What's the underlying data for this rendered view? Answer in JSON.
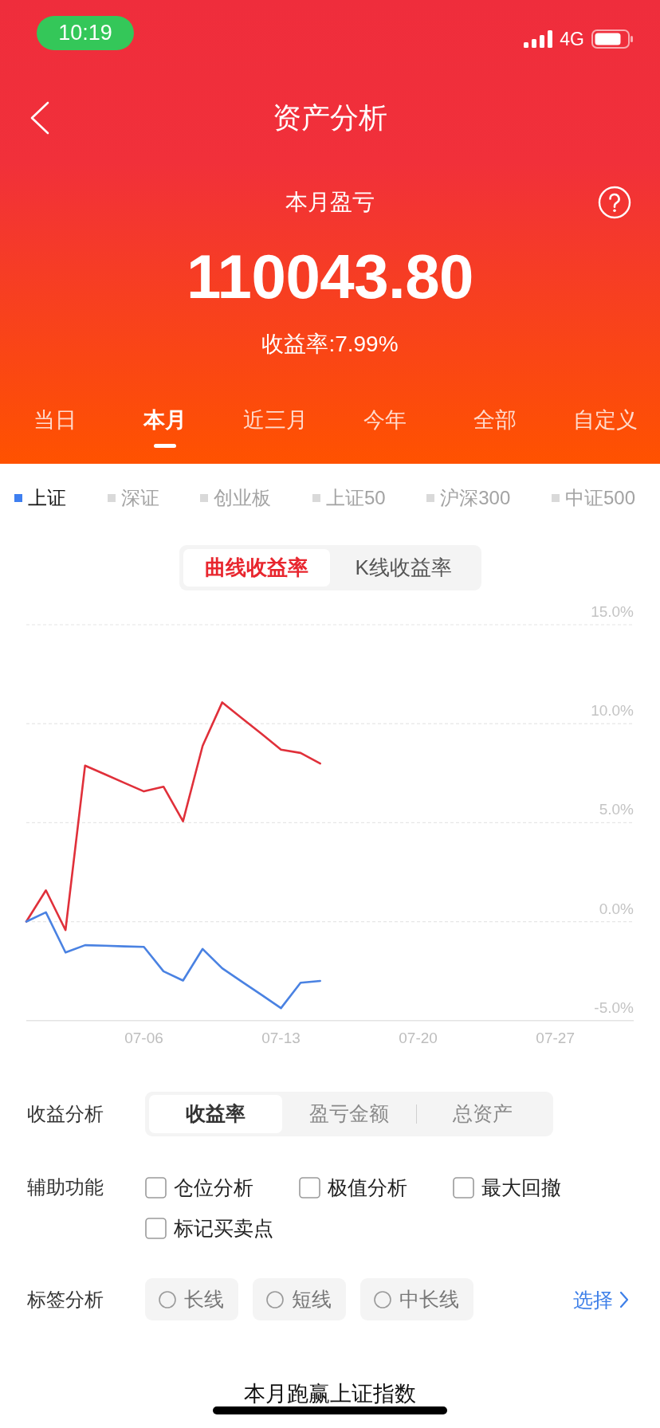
{
  "status_bar": {
    "time": "10:19",
    "network": "4G"
  },
  "nav": {
    "title": "资产分析"
  },
  "summary": {
    "label": "本月盈亏",
    "amount": "110043.80",
    "return_rate": "收益率:7.99%"
  },
  "period_tabs": [
    {
      "label": "当日",
      "selected": false
    },
    {
      "label": "本月",
      "selected": true
    },
    {
      "label": "近三月",
      "selected": false
    },
    {
      "label": "今年",
      "selected": false
    },
    {
      "label": "全部",
      "selected": false
    },
    {
      "label": "自定义",
      "selected": false
    }
  ],
  "index_legend": [
    {
      "label": "上证",
      "selected": true
    },
    {
      "label": "深证",
      "selected": false
    },
    {
      "label": "创业板",
      "selected": false
    },
    {
      "label": "上证50",
      "selected": false
    },
    {
      "label": "沪深300",
      "selected": false
    },
    {
      "label": "中证500",
      "selected": false
    }
  ],
  "chart_mode_tabs": [
    {
      "label": "曲线收益率",
      "selected": true
    },
    {
      "label": "K线收益率",
      "selected": false
    }
  ],
  "chart": {
    "chart_data": {
      "type": "line",
      "grid": true,
      "categories": [
        null,
        null,
        null,
        null,
        null,
        null,
        "07-06",
        null,
        null,
        null,
        null,
        null,
        null,
        "07-13",
        null,
        null,
        null,
        null,
        null,
        null,
        "07-20",
        null,
        null,
        null,
        null,
        null,
        null,
        "07-27",
        null,
        null,
        null,
        null
      ],
      "ylim": [
        -5,
        15
      ],
      "yticks": [
        {
          "value": -5,
          "label": "-5.0%"
        },
        {
          "value": 0,
          "label": "0.0%"
        },
        {
          "value": 5,
          "label": "5.0%"
        },
        {
          "value": 10,
          "label": "10.0%"
        },
        {
          "value": 15,
          "label": "15.0%"
        }
      ],
      "series": [
        {
          "color": "#e0303a",
          "values": [
            0,
            1.58,
            -0.43,
            7.88,
            7.45,
            7.01,
            6.58,
            6.82,
            5.07,
            8.88,
            11.08,
            10.28,
            9.49,
            8.69,
            8.52,
            7.99,
            null,
            null,
            null,
            null,
            null,
            null,
            null,
            null,
            null,
            null,
            null,
            null,
            null,
            null,
            null,
            null
          ]
        },
        {
          "color": "#4a82e2",
          "values": [
            0,
            0.47,
            -1.56,
            -1.19,
            -1.22,
            -1.25,
            -1.28,
            -2.51,
            -2.98,
            -1.38,
            -2.36,
            -3.03,
            -3.7,
            -4.37,
            -3.09,
            -3.0,
            null,
            null,
            null,
            null,
            null,
            null,
            null,
            null,
            null,
            null,
            null,
            null,
            null,
            null,
            null,
            null
          ]
        }
      ]
    }
  },
  "profit_analysis": {
    "label": "收益分析",
    "options": [
      {
        "label": "收益率",
        "selected": true
      },
      {
        "label": "盈亏金额",
        "selected": false
      },
      {
        "label": "总资产",
        "selected": false
      }
    ]
  },
  "aux_functions": {
    "label": "辅助功能",
    "options": [
      {
        "label": "仓位分析",
        "checked": false
      },
      {
        "label": "极值分析",
        "checked": false
      },
      {
        "label": "最大回撤",
        "checked": false
      },
      {
        "label": "标记买卖点",
        "checked": false
      }
    ]
  },
  "tag_analysis": {
    "label": "标签分析",
    "options": [
      {
        "label": "长线",
        "selected": false
      },
      {
        "label": "短线",
        "selected": false
      },
      {
        "label": "中长线",
        "selected": false
      }
    ],
    "action": "选择"
  },
  "footer": {
    "title": "本月跑赢上证指数"
  }
}
